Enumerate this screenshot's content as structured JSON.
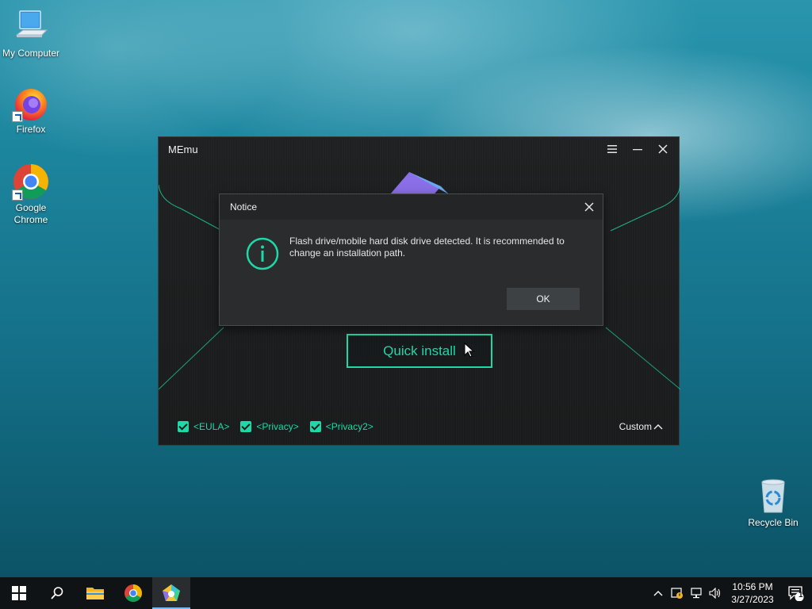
{
  "desktop": {
    "icons": [
      {
        "label": "My Computer",
        "icon": "computer-icon"
      },
      {
        "label": "Firefox",
        "icon": "firefox-icon"
      },
      {
        "label": "Google Chrome",
        "icon": "chrome-icon"
      },
      {
        "label": "Recycle Bin",
        "icon": "recycle-bin-icon"
      }
    ]
  },
  "memu": {
    "title": "MEmu",
    "quick_install": "Quick install",
    "checks": [
      "<EULA>",
      "<Privacy>",
      "<Privacy2>"
    ],
    "custom": "Custom",
    "accent": "#1ed8a8"
  },
  "notice": {
    "title": "Notice",
    "message": "Flash drive/mobile hard disk drive detected. It is recommended to change an installation path.",
    "ok": "OK"
  },
  "taskbar": {
    "time": "10:56 PM",
    "date": "3/27/2023",
    "notification_count": "1"
  }
}
